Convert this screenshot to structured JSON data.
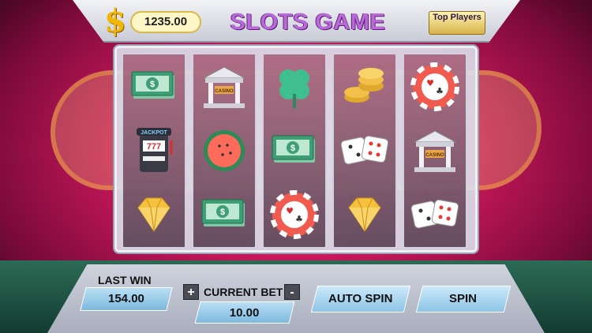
{
  "header": {
    "balance": "1235.00",
    "title": "SLOTS GAME",
    "top_players": "Top Players"
  },
  "reels": [
    [
      "cash-icon",
      "jackpot-machine-icon",
      "diamond-icon"
    ],
    [
      "casino-building-icon",
      "watermelon-icon",
      "cash-icon"
    ],
    [
      "clover-icon",
      "cash-icon",
      "poker-chip-icon"
    ],
    [
      "coins-stack-icon",
      "dice-icon",
      "diamond-icon"
    ],
    [
      "poker-chip-icon",
      "casino-building-icon",
      "dice-icon"
    ]
  ],
  "symbol_labels": {
    "jackpot": "JACKPOT",
    "sevens": "777",
    "casino": "CASINO"
  },
  "bottom": {
    "last_win_label": "LAST WIN",
    "last_win_value": "154.00",
    "current_bet_label": "CURRENT BET",
    "current_bet_value": "10.00",
    "plus": "+",
    "minus": "-",
    "auto_spin": "AUTO SPIN",
    "spin": "SPIN"
  },
  "colors": {
    "accent_gold": "#f2b705",
    "title_purple": "#ba6ad8",
    "button_blue": "#8dc4e6"
  }
}
